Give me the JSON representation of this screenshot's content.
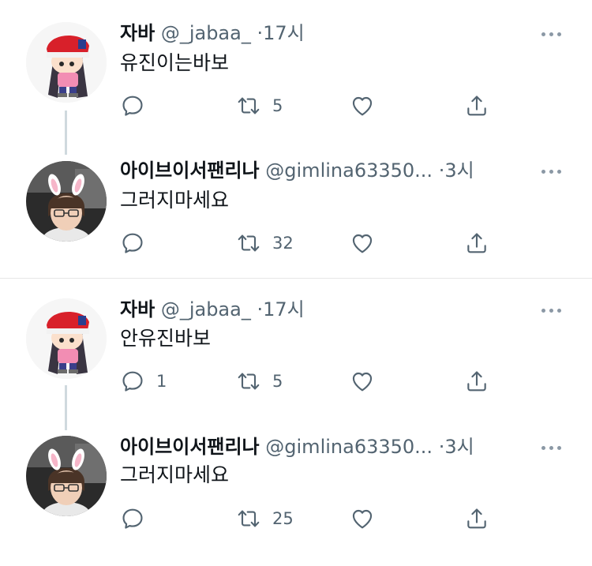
{
  "threads": [
    {
      "tweet": {
        "name": "자바",
        "handle": "@_jabaa_",
        "sep": "·",
        "time": "17시",
        "text": "유진이는바보",
        "reply_count": "",
        "retweet_count": "5",
        "like_count": ""
      },
      "reply": {
        "name": "아이브이서팬리나",
        "handle": "@gimlina63350...",
        "sep": "·",
        "time": "3시",
        "text": "그러지마세요",
        "reply_count": "",
        "retweet_count": "32",
        "like_count": ""
      }
    },
    {
      "tweet": {
        "name": "자바",
        "handle": "@_jabaa_",
        "sep": "·",
        "time": "17시",
        "text": "안유진바보",
        "reply_count": "1",
        "retweet_count": "5",
        "like_count": ""
      },
      "reply": {
        "name": "아이브이서팬리나",
        "handle": "@gimlina63350...",
        "sep": "·",
        "time": "3시",
        "text": "그러지마세요",
        "reply_count": "",
        "retweet_count": "25",
        "like_count": ""
      }
    }
  ],
  "icons": {
    "reply": "reply-icon",
    "retweet": "retweet-icon",
    "like": "heart-icon",
    "share": "share-icon",
    "more": "more-icon"
  },
  "colors": {
    "text": "#0f1419",
    "secondary": "#536471",
    "thread_line": "#cfd9de",
    "divider": "#e7e7e7"
  }
}
